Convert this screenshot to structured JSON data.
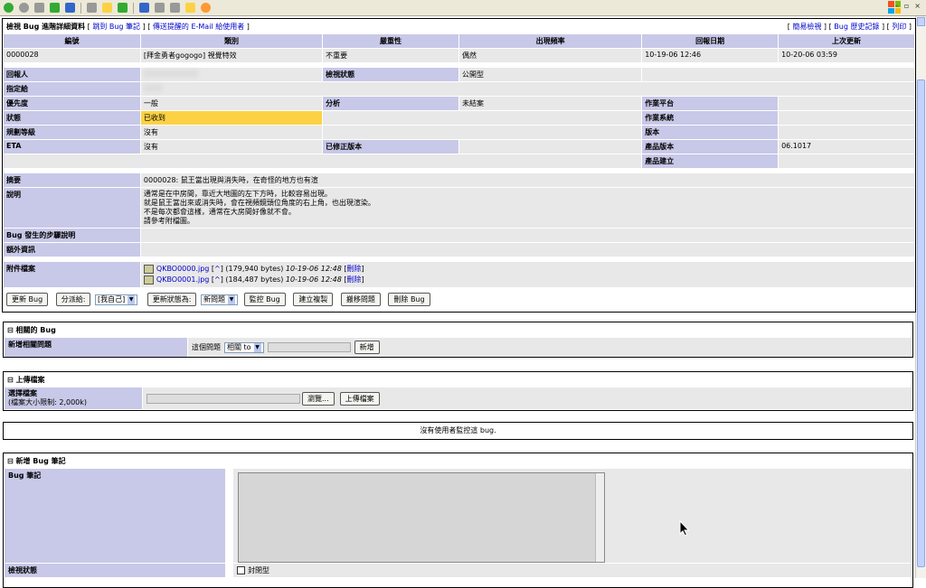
{
  "page": {
    "title": "檢視 Bug 進階詳細資料",
    "jump_note": "跳到 Bug 筆記",
    "send_email": "傳送提醒的 E-Mail 給使用者",
    "right_links": [
      "簡易檢視",
      "Bug 歷史記錄",
      "列印"
    ]
  },
  "columns": [
    "編號",
    "類別",
    "嚴重性",
    "出現頻率",
    "回報日期",
    "上次更新"
  ],
  "bug": {
    "id": "0000028",
    "category": "[拜金勇者gogogo] 視覺特效",
    "severity": "不重要",
    "frequency": "偶然",
    "reported": "10-19-06 12:46",
    "updated": "10-20-06 03:59"
  },
  "fields": {
    "reporter_label": "回報人",
    "view_status_label": "檢視狀態",
    "view_status": "公開型",
    "assigned_label": "指定給",
    "priority_label": "優先度",
    "priority": "一般",
    "resolution_label": "分析",
    "resolution": "未結案",
    "platform_label": "作業平台",
    "status_label": "狀態",
    "status": "已收到",
    "os_label": "作業系統",
    "projection_label": "規劃等級",
    "projection": "沒有",
    "version_label": "版本",
    "eta_label": "ETA",
    "eta": "沒有",
    "fixed_label": "已修正版本",
    "product_version_label": "產品版本",
    "product_version": "06.1017",
    "build_label": "產品建立",
    "summary_label": "摘要",
    "summary": "0000028: 鼠王當出現與消失時，在奇怪的地方也有渲",
    "description_label": "說明",
    "description": [
      "通常是在中房間，靠近大地圖的左下方時，比較容易出現。",
      "就是鼠王當出來或消失時，會在視頻鏡頭位角度的右上角，也出現渲染。",
      "不是每次都會這樣，通常在大房間好像就不會。",
      "請參考附檔圖。"
    ],
    "steps_label": "Bug 發生的步驟說明",
    "extra_label": "額外資訊",
    "attach_label": "附件檔案"
  },
  "attachments": [
    {
      "name": "QKBO0000.jpg",
      "open": "^",
      "size": "(179,940 bytes)",
      "date": "10-19-06 12:48",
      "delete": "刪除"
    },
    {
      "name": "QKBO0001.jpg",
      "open": "^",
      "size": "(184,487 bytes)",
      "date": "10-19-06 12:48",
      "delete": "刪除"
    }
  ],
  "actions": {
    "update": "更新 Bug",
    "assign": "分派給:",
    "assign_select": "[我自己]",
    "change_status": "更新狀態為:",
    "status_select": "新問題",
    "monitor": "監控 Bug",
    "clone": "建立複製",
    "move": "搬移問題",
    "delete": "刪除 Bug"
  },
  "related": {
    "header": "相關的 Bug",
    "new_label": "新增相關問題",
    "current_label": "這個問題",
    "relation_select": "相關 to",
    "add_button": "新增"
  },
  "upload": {
    "header": "上傳檔案",
    "select_label": "選擇檔案",
    "max_size": "(檔案大小限制: 2,000k)",
    "browse": "瀏覽...",
    "upload_button": "上傳檔案"
  },
  "monitor_note": "沒有使用者監控這 bug.",
  "note": {
    "header": "新增 Bug 筆記",
    "label": "Bug 筆記",
    "view_status_label": "檢視狀態",
    "private_label": "封閉型"
  },
  "colors": {
    "label_bg": "#c8c8e8",
    "value_bg": "#e8e8e8",
    "status_yellow": "#fcd244"
  }
}
